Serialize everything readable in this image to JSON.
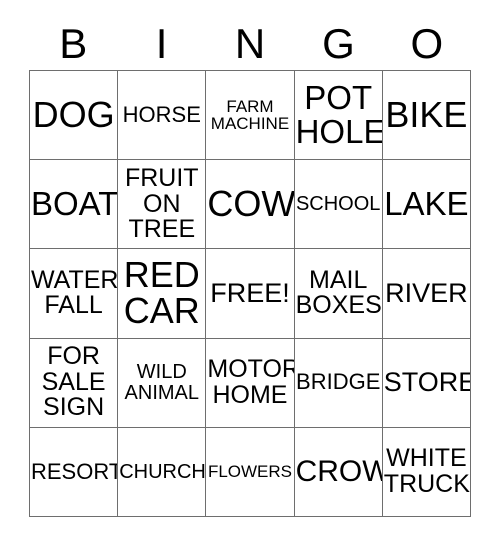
{
  "card": {
    "title": "BINGO Card",
    "header_letters": [
      "B",
      "I",
      "N",
      "G",
      "O"
    ],
    "columns": 5,
    "rows": 5,
    "grid_line_color": "#6e6e6e",
    "background_color": "#ffffff",
    "text_color": "#000000",
    "free_space": "FREE!",
    "cells": [
      [
        {
          "text": "DOG",
          "lines": [
            "DOG"
          ],
          "size": "xxl"
        },
        {
          "text": "HORSE",
          "lines": [
            "HORSE"
          ],
          "size": "sm"
        },
        {
          "text": "FARM MACHINE",
          "lines": [
            "FARM",
            "MACHINE"
          ],
          "size": "xs"
        },
        {
          "text": "POT HOLE",
          "lines": [
            "POT",
            "HOLE"
          ],
          "size": "xl"
        },
        {
          "text": "BIKE",
          "lines": [
            "BIKE"
          ],
          "size": "xxl"
        }
      ],
      [
        {
          "text": "BOAT",
          "lines": [
            "BOAT"
          ],
          "size": "xl"
        },
        {
          "text": "FRUIT ON TREE",
          "lines": [
            "FRUIT",
            "ON",
            "TREE"
          ],
          "size": "m"
        },
        {
          "text": "COW",
          "lines": [
            "COW"
          ],
          "size": "xxl"
        },
        {
          "text": "SCHOOL",
          "lines": [
            "SCHOOL"
          ],
          "size": "s"
        },
        {
          "text": "LAKE",
          "lines": [
            "LAKE"
          ],
          "size": "xl"
        }
      ],
      [
        {
          "text": "WATER FALL",
          "lines": [
            "WATER",
            "FALL"
          ],
          "size": "m"
        },
        {
          "text": "RED CAR",
          "lines": [
            "RED",
            "CAR"
          ],
          "size": "xxl"
        },
        {
          "text": "FREE!",
          "lines": [
            "FREE!"
          ],
          "size": "ml"
        },
        {
          "text": "MAIL BOXES",
          "lines": [
            "MAIL",
            "BOXES"
          ],
          "size": "m"
        },
        {
          "text": "RIVER",
          "lines": [
            "RIVER"
          ],
          "size": "ml"
        }
      ],
      [
        {
          "text": "FOR SALE SIGN",
          "lines": [
            "FOR",
            "SALE",
            "SIGN"
          ],
          "size": "m"
        },
        {
          "text": "WILD ANIMAL",
          "lines": [
            "WILD",
            "ANIMAL"
          ],
          "size": "s"
        },
        {
          "text": "MOTOR HOME",
          "lines": [
            "MOTOR",
            "HOME"
          ],
          "size": "m"
        },
        {
          "text": "BRIDGE",
          "lines": [
            "BRIDGE"
          ],
          "size": "sm"
        },
        {
          "text": "STORE",
          "lines": [
            "STORE"
          ],
          "size": "ml"
        }
      ],
      [
        {
          "text": "RESORT",
          "lines": [
            "RESORT"
          ],
          "size": "sm"
        },
        {
          "text": "CHURCH",
          "lines": [
            "CHURCH"
          ],
          "size": "s"
        },
        {
          "text": "FLOWERS",
          "lines": [
            "FLOWERS"
          ],
          "size": "xs"
        },
        {
          "text": "CROW",
          "lines": [
            "CROW"
          ],
          "size": "l"
        },
        {
          "text": "WHITE TRUCK",
          "lines": [
            "WHITE",
            "TRUCK"
          ],
          "size": "m"
        }
      ]
    ]
  }
}
